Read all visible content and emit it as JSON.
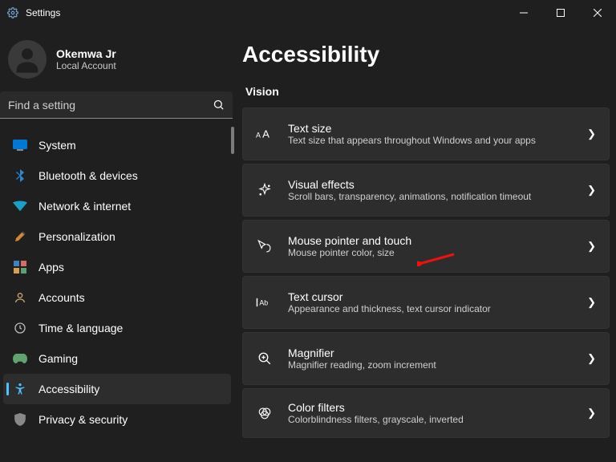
{
  "titlebar": {
    "app_name": "Settings"
  },
  "user": {
    "name": "Okemwa Jr",
    "sub": "Local Account"
  },
  "search": {
    "placeholder": "Find a setting"
  },
  "nav": [
    {
      "label": "System",
      "icon": "system"
    },
    {
      "label": "Bluetooth & devices",
      "icon": "bluetooth"
    },
    {
      "label": "Network & internet",
      "icon": "wifi"
    },
    {
      "label": "Personalization",
      "icon": "brush"
    },
    {
      "label": "Apps",
      "icon": "apps"
    },
    {
      "label": "Accounts",
      "icon": "accounts"
    },
    {
      "label": "Time & language",
      "icon": "time"
    },
    {
      "label": "Gaming",
      "icon": "gaming"
    },
    {
      "label": "Accessibility",
      "icon": "access",
      "active": true
    },
    {
      "label": "Privacy & security",
      "icon": "privacy"
    }
  ],
  "page": {
    "title": "Accessibility",
    "section": "Vision"
  },
  "cards": [
    {
      "icon": "textsize",
      "title": "Text size",
      "sub": "Text size that appears throughout Windows and your apps"
    },
    {
      "icon": "sparkle",
      "title": "Visual effects",
      "sub": "Scroll bars, transparency, animations, notification timeout"
    },
    {
      "icon": "pointer",
      "title": "Mouse pointer and touch",
      "sub": "Mouse pointer color, size"
    },
    {
      "icon": "cursor",
      "title": "Text cursor",
      "sub": "Appearance and thickness, text cursor indicator"
    },
    {
      "icon": "magnifier",
      "title": "Magnifier",
      "sub": "Magnifier reading, zoom increment"
    },
    {
      "icon": "filters",
      "title": "Color filters",
      "sub": "Colorblindness filters, grayscale, inverted"
    }
  ]
}
